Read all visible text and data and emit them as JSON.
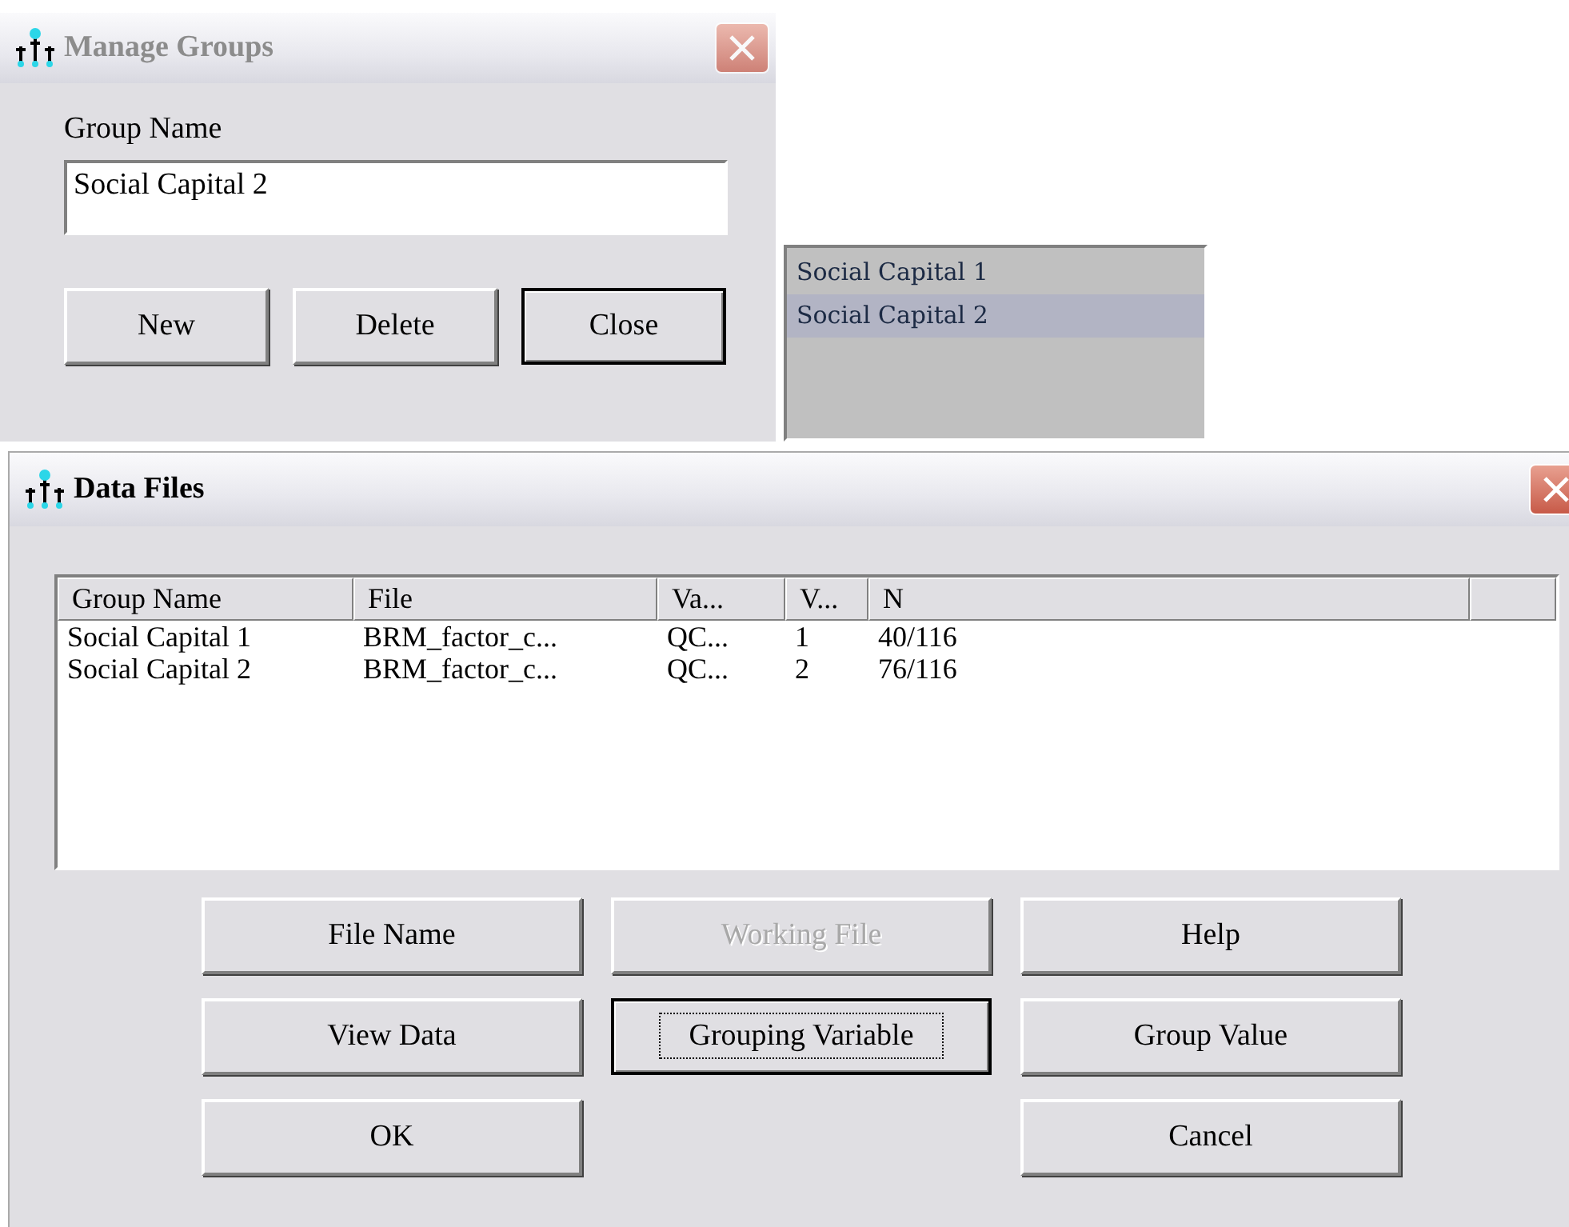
{
  "manage_groups": {
    "title": "Manage Groups",
    "active": false,
    "group_name_label": "Group Name",
    "group_name_value": "Social Capital 2",
    "buttons": [
      {
        "label": "New",
        "default": false,
        "disabled": false
      },
      {
        "label": "Delete",
        "default": false,
        "disabled": false
      },
      {
        "label": "Close",
        "default": true,
        "disabled": false
      }
    ]
  },
  "group_list": [
    {
      "label": "Social Capital 1",
      "selected": false
    },
    {
      "label": "Social Capital 2",
      "selected": true
    }
  ],
  "data_files": {
    "title": "Data Files",
    "active": true,
    "table": {
      "columns": [
        "Group Name",
        "File",
        "Va...",
        "V...",
        "N"
      ],
      "rows": [
        [
          "Social Capital 1",
          "BRM_factor_c...",
          "QC...",
          "1",
          "40/116"
        ],
        [
          "Social Capital 2",
          "BRM_factor_c...",
          "QC...",
          "2",
          "76/116"
        ]
      ]
    },
    "buttons": [
      {
        "label": "File Name",
        "default": false,
        "disabled": false
      },
      {
        "label": "Working File",
        "default": false,
        "disabled": true
      },
      {
        "label": "Help",
        "default": false,
        "disabled": false
      },
      {
        "label": "View Data",
        "default": false,
        "disabled": false
      },
      {
        "label": "Grouping Variable",
        "default": true,
        "disabled": false
      },
      {
        "label": "Group Value",
        "default": false,
        "disabled": false
      },
      {
        "label": "OK",
        "default": false,
        "disabled": false
      },
      {
        "label": "Cancel",
        "default": false,
        "disabled": false
      }
    ]
  }
}
